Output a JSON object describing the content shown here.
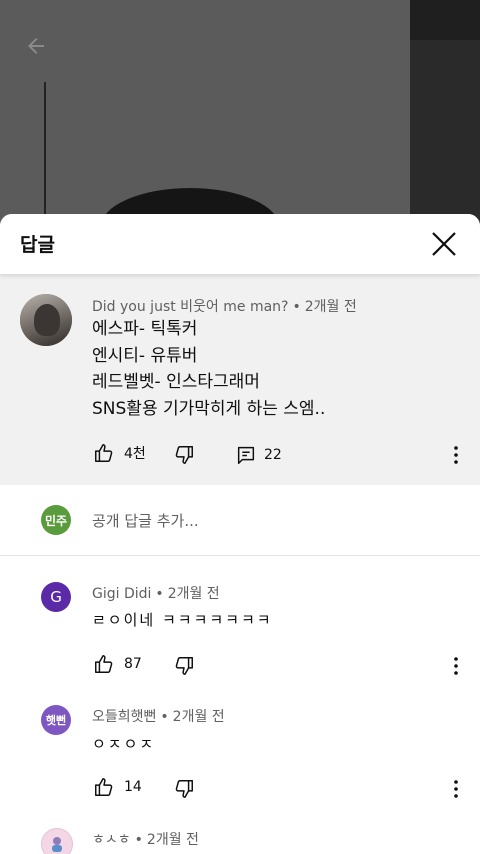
{
  "sheet": {
    "title": "답글"
  },
  "parent_comment": {
    "author": "Did you just 비웃어 me man?",
    "time": "2개월 전",
    "lines": [
      "에스파- 틱톡커",
      "엔시티- 유튜버",
      "레드벨벳- 인스타그래머",
      "SNS활용 기가막히게 하는 스엠.."
    ],
    "likes": "4천",
    "replies": "22"
  },
  "reply_input": {
    "avatar_text": "민주",
    "placeholder": "공개 답글 추가..."
  },
  "replies": [
    {
      "avatar_text": "G",
      "avatar_color": "#5b2aa6",
      "author": "Gigi Didi",
      "time": "2개월 전",
      "text": "ㄹㅇ이네 ㅋㅋㅋㅋㅋㅋㅋ",
      "likes": "87"
    },
    {
      "avatar_text": "햇뻔",
      "avatar_color": "#7e57c2",
      "author": "오들희햇뻔",
      "time": "2개월 전",
      "text": "ㅇㅈㅇㅈ",
      "likes": "14"
    },
    {
      "avatar_text": "",
      "avatar_color": "#f3d7e6",
      "author": "ㅎㅅㅎ",
      "time": "2개월 전"
    }
  ],
  "colors": {
    "sheet_bg": "#ffffff",
    "parent_bg": "#f1f1f1",
    "meta_text": "#606060",
    "reply_avatar_green": "#5a9b3b"
  }
}
